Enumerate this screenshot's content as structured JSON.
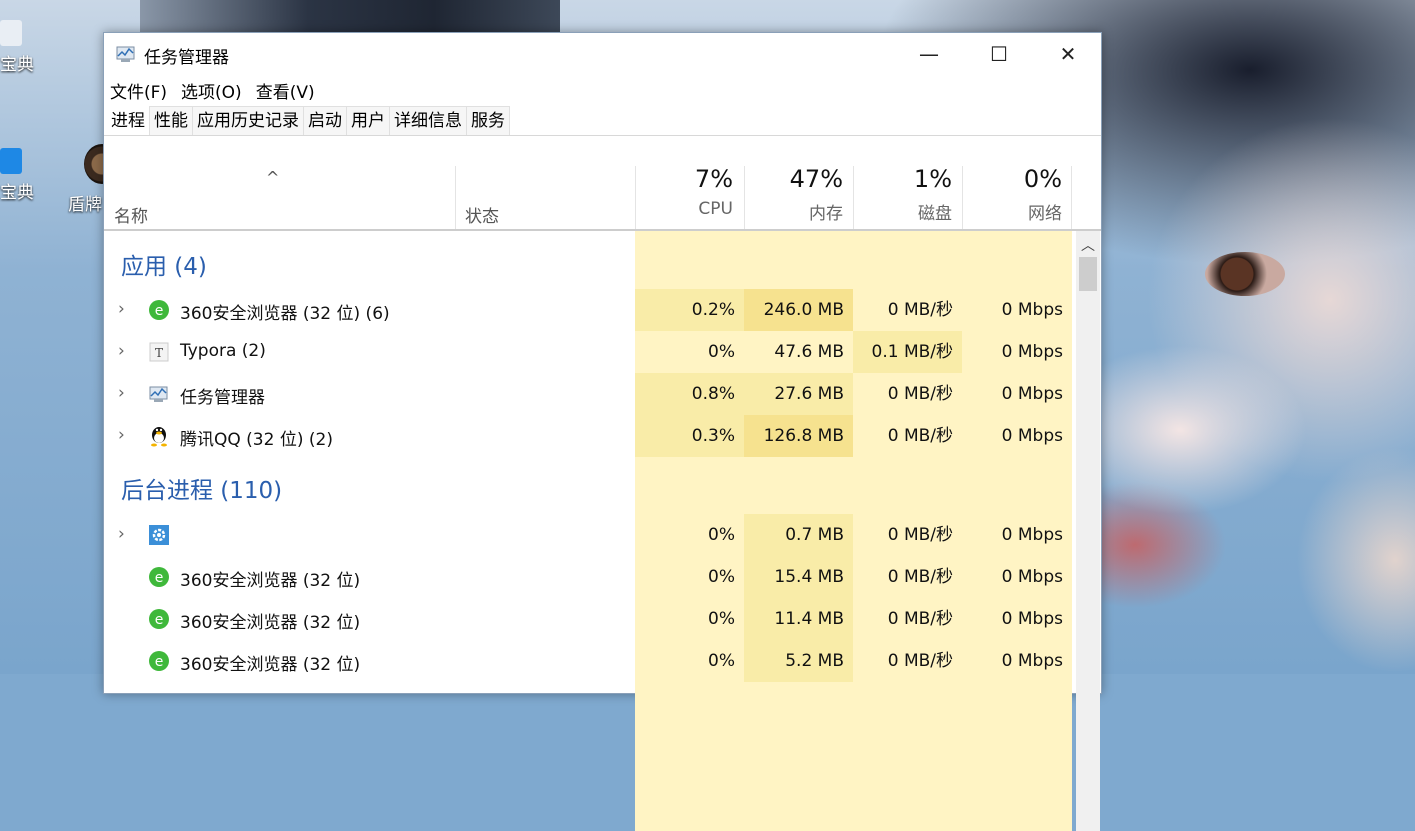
{
  "desktop": {
    "icon1_label": "宝典",
    "icon2_label": "宝典",
    "icon3_label": "盾牌"
  },
  "window": {
    "title": "任务管理器",
    "minimize": "—",
    "maximize": "☐",
    "close": "✕"
  },
  "menu": [
    "文件(F)",
    "选项(O)",
    "查看(V)"
  ],
  "tabs": [
    "进程",
    "性能",
    "应用历史记录",
    "启动",
    "用户",
    "详细信息",
    "服务"
  ],
  "header": {
    "sort_caret": "^",
    "name": "名称",
    "status": "状态",
    "cpu": {
      "pct": "7%",
      "label": "CPU"
    },
    "memory": {
      "pct": "47%",
      "label": "内存"
    },
    "disk": {
      "pct": "1%",
      "label": "磁盘"
    },
    "network": {
      "pct": "0%",
      "label": "网络"
    }
  },
  "groups": {
    "apps": "应用 (4)",
    "background": "后台进程 (110)"
  },
  "rows": [
    {
      "expand": "›",
      "icon": "360-browser-icon",
      "name": "360安全浏览器 (32 位) (6)",
      "cpu": "0.2%",
      "mem": "246.0 MB",
      "disk": "0 MB/秒",
      "net": "0 Mbps"
    },
    {
      "expand": "›",
      "icon": "typora-icon",
      "name": "Typora (2)",
      "cpu": "0%",
      "mem": "47.6 MB",
      "disk": "0.1 MB/秒",
      "net": "0 Mbps"
    },
    {
      "expand": "›",
      "icon": "task-manager-icon",
      "name": "任务管理器",
      "cpu": "0.8%",
      "mem": "27.6 MB",
      "disk": "0 MB/秒",
      "net": "0 Mbps"
    },
    {
      "expand": "›",
      "icon": "qq-icon",
      "name": "腾讯QQ (32 位) (2)",
      "cpu": "0.3%",
      "mem": "126.8 MB",
      "disk": "0 MB/秒",
      "net": "0 Mbps"
    },
    {
      "expand": "›",
      "icon": "gear-icon",
      "name": "",
      "cpu": "0%",
      "mem": "0.7 MB",
      "disk": "0 MB/秒",
      "net": "0 Mbps"
    },
    {
      "expand": "",
      "icon": "360-browser-icon",
      "name": "360安全浏览器 (32 位)",
      "cpu": "0%",
      "mem": "15.4 MB",
      "disk": "0 MB/秒",
      "net": "0 Mbps"
    },
    {
      "expand": "",
      "icon": "360-browser-icon",
      "name": "360安全浏览器 (32 位)",
      "cpu": "0%",
      "mem": "11.4 MB",
      "disk": "0 MB/秒",
      "net": "0 Mbps"
    },
    {
      "expand": "",
      "icon": "360-browser-icon",
      "name": "360安全浏览器 (32 位)",
      "cpu": "0%",
      "mem": "5.2 MB",
      "disk": "0 MB/秒",
      "net": "0 Mbps"
    }
  ],
  "colors": {
    "heat_light": "#fff4c4",
    "heat_medium": "#f9eca8",
    "heat_dark": "#f6e28f",
    "group_title": "#2a5ead"
  }
}
